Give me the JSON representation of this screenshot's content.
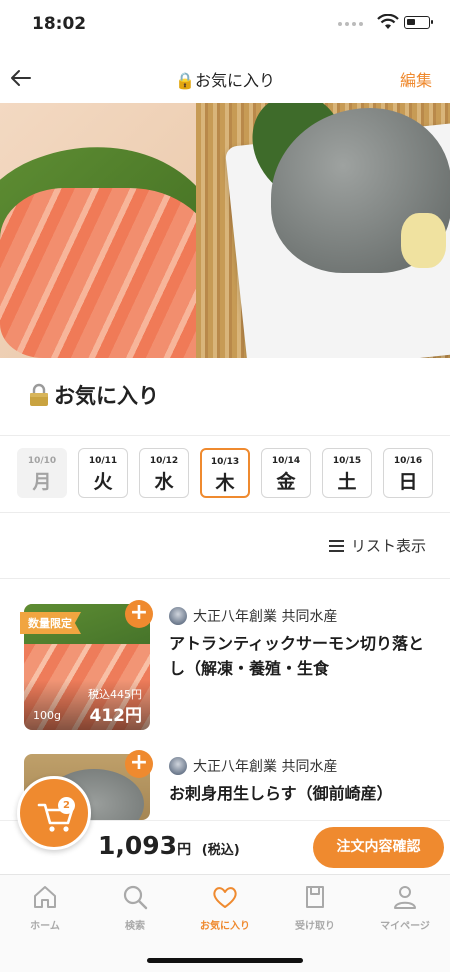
{
  "status_bar": {
    "time": "18:02"
  },
  "nav": {
    "title": "🔒お気に入り",
    "edit_label": "編集"
  },
  "page_title": "お気に入り",
  "days": [
    {
      "date": "10/10",
      "weekday": "月",
      "state": "disabled"
    },
    {
      "date": "10/11",
      "weekday": "火",
      "state": "normal"
    },
    {
      "date": "10/12",
      "weekday": "水",
      "state": "normal"
    },
    {
      "date": "10/13",
      "weekday": "木",
      "state": "selected"
    },
    {
      "date": "10/14",
      "weekday": "金",
      "state": "normal"
    },
    {
      "date": "10/15",
      "weekday": "土",
      "state": "normal"
    },
    {
      "date": "10/16",
      "weekday": "日",
      "state": "normal"
    }
  ],
  "list_view_label": "リスト表示",
  "products": [
    {
      "badge": "数量限定",
      "shop": "大正八年創業 共同水産",
      "name": "アトランティックサーモン切り落とし（解凍・養殖・生食",
      "price_with_tax": "税込445円",
      "weight": "100g",
      "price": "412円"
    },
    {
      "shop": "大正八年創業 共同水産",
      "name": "お刺身用生しらす（御前崎産）"
    }
  ],
  "cart": {
    "count": "2",
    "total": "1,093",
    "yen": "円",
    "tax_note": "(税込)",
    "confirm_label": "注文内容確認"
  },
  "tabs": [
    {
      "label": "ホーム",
      "icon": "home-icon"
    },
    {
      "label": "検索",
      "icon": "search-icon"
    },
    {
      "label": "お気に入り",
      "icon": "heart-icon",
      "active": true
    },
    {
      "label": "受け取り",
      "icon": "bag-icon"
    },
    {
      "label": "マイページ",
      "icon": "user-icon"
    }
  ],
  "colors": {
    "accent": "#ef8a2f",
    "badge": "#f1a540",
    "muted": "#a9a9a9"
  }
}
